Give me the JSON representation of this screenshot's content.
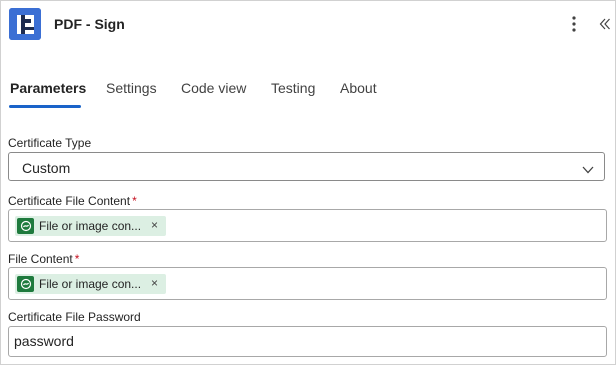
{
  "header": {
    "title": "PDF - Sign",
    "app_icon": "pdf-connector-icon",
    "more_icon": "more-vertical-icon",
    "collapse_icon": "double-chevron-left-icon"
  },
  "tabs": [
    {
      "label": "Parameters",
      "active": true
    },
    {
      "label": "Settings",
      "active": false
    },
    {
      "label": "Code view",
      "active": false
    },
    {
      "label": "Testing",
      "active": false
    },
    {
      "label": "About",
      "active": false
    }
  ],
  "fields": {
    "certificate_type": {
      "label": "Certificate Type",
      "value": "Custom",
      "required": false
    },
    "certificate_file_content": {
      "label": "Certificate File Content",
      "required_mark": "*",
      "token_label": "File or image con...",
      "token_close": "×"
    },
    "file_content": {
      "label": "File Content",
      "required_mark": "*",
      "token_label": "File or image con...",
      "token_close": "×"
    },
    "certificate_file_password": {
      "label": "Certificate File Password",
      "value": "password"
    }
  },
  "colors": {
    "accent": "#1a63c9",
    "token_bg": "#dcefe3",
    "token_icon": "#1e7a3d",
    "required": "#c50f1f",
    "app_icon_bg": "#3b6fd4"
  }
}
